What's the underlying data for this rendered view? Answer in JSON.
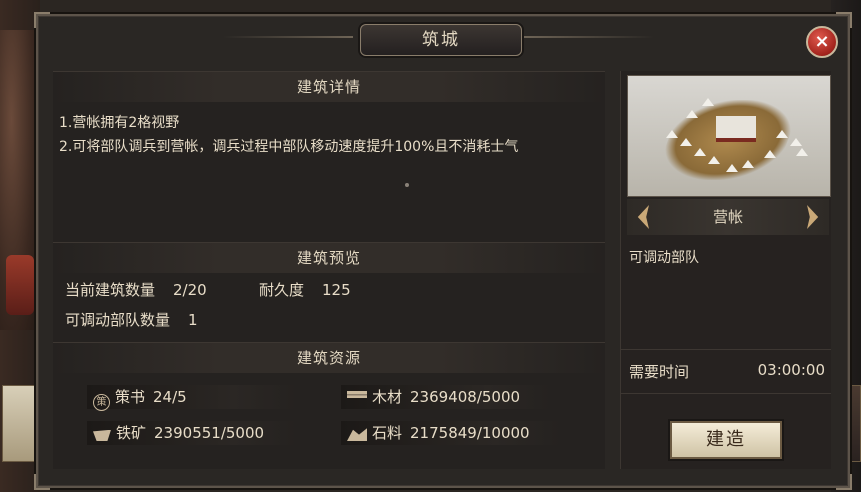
{
  "window": {
    "title": "筑城",
    "close_label": "×"
  },
  "details": {
    "heading": "建筑详情",
    "line1": "1.营帐拥有2格视野",
    "line2": "2.可将部队调兵到营帐，调兵过程中部队移动速度提升100%且不消耗士气"
  },
  "preview_section": {
    "heading": "建筑预览",
    "current_count_label": "当前建筑数量",
    "current_count_value": "2/20",
    "durability_label": "耐久度",
    "durability_value": "125",
    "troops_label": "可调动部队数量",
    "troops_value": "1"
  },
  "resources": {
    "heading": "建筑资源",
    "items": [
      {
        "icon": "strategy-book-icon",
        "icon_text": "策",
        "name": "策书",
        "value": "24/5"
      },
      {
        "icon": "wood-icon",
        "name": "木材",
        "value": "2369408/5000"
      },
      {
        "icon": "iron-icon",
        "name": "铁矿",
        "value": "2390551/5000"
      },
      {
        "icon": "stone-icon",
        "name": "石料",
        "value": "2175849/10000"
      }
    ]
  },
  "building": {
    "name": "营帐",
    "description": "可调动部队",
    "time_label": "需要时间",
    "time_value": "03:00:00",
    "build_label": "建造"
  },
  "colors": {
    "accent": "#c9a877",
    "text": "#e8ddc8",
    "panel": "#252220"
  }
}
